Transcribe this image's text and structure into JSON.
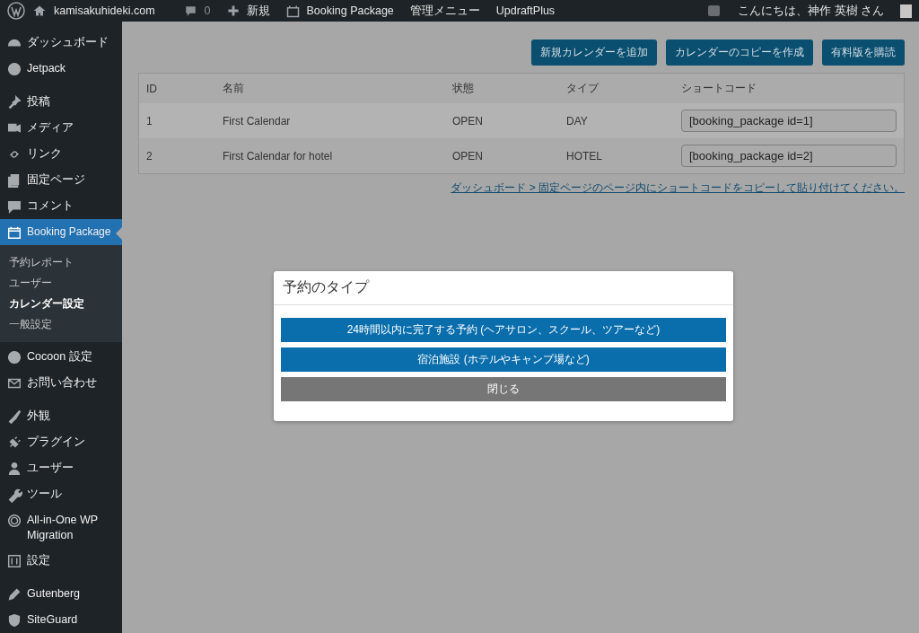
{
  "admin_bar": {
    "site": "kamisakuhideki.com",
    "comments": "0",
    "new": "新規",
    "plugin": "Booking Package",
    "menu": "管理メニュー",
    "updraft": "UpdraftPlus",
    "greeting": "こんにちは、神作 英樹 さん"
  },
  "sidebar": {
    "groups": [
      [
        {
          "label": "ダッシュボード",
          "selected": false
        },
        {
          "label": "Jetpack",
          "selected": false
        }
      ],
      [
        {
          "label": "投稿",
          "selected": false
        },
        {
          "label": "メディア",
          "selected": false
        },
        {
          "label": "リンク",
          "selected": false
        },
        {
          "label": "固定ページ",
          "selected": false
        },
        {
          "label": "コメント",
          "selected": false
        },
        {
          "label": "Booking Package",
          "selected": true,
          "children": [
            {
              "label": "予約レポート",
              "selected": false
            },
            {
              "label": "ユーザー",
              "selected": false
            },
            {
              "label": "カレンダー設定",
              "selected": true
            },
            {
              "label": "一般設定",
              "selected": false
            }
          ]
        },
        {
          "label": "Cocoon 設定",
          "selected": false
        },
        {
          "label": "お問い合わせ",
          "selected": false
        }
      ],
      [
        {
          "label": "外観",
          "selected": false
        },
        {
          "label": "プラグイン",
          "selected": false
        },
        {
          "label": "ユーザー",
          "selected": false
        },
        {
          "label": "ツール",
          "selected": false
        },
        {
          "label": "All-in-One WP Migration",
          "selected": false
        },
        {
          "label": "設定",
          "selected": false
        }
      ],
      [
        {
          "label": "Gutenberg",
          "selected": false
        },
        {
          "label": "SiteGuard",
          "selected": false
        }
      ]
    ]
  },
  "actions": [
    "新規カレンダーを追加",
    "カレンダーのコピーを作成",
    "有料版を購読"
  ],
  "table": {
    "columns": [
      "ID",
      "名前",
      "状態",
      "タイプ",
      "ショートコード"
    ],
    "rows": [
      {
        "id": "1",
        "name": "First Calendar",
        "status": "OPEN",
        "type": "DAY",
        "shortcode": "[booking_package id=1]"
      },
      {
        "id": "2",
        "name": "First Calendar for hotel",
        "status": "OPEN",
        "type": "HOTEL",
        "shortcode": "[booking_package id=2]"
      }
    ]
  },
  "hint_link": "ダッシュボード > 固定ページのページ内にショートコードをコピーして貼り付けてください。",
  "dialog": {
    "title": "予約のタイプ",
    "buttons": [
      {
        "label": "24時間以内に完了する予約 (ヘアサロン、スクール、ツアーなど)",
        "kind": "primary"
      },
      {
        "label": "宿泊施設 (ホテルやキャンプ場など)",
        "kind": "primary"
      },
      {
        "label": "閉じる",
        "kind": "secondary"
      }
    ]
  }
}
